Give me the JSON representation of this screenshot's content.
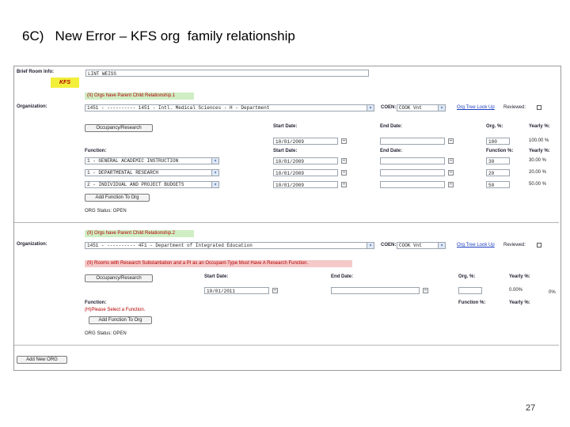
{
  "slide": {
    "title": "6C)   New Error – KFS org  family relationship",
    "page_number": "27"
  },
  "colors": {
    "accent_link": "#1d3fbf",
    "error_text": "#b30000",
    "kfs_badge": "#f2ef3a",
    "info_green": "#cfeec4",
    "error_red": "#f5c9c9"
  },
  "header": {
    "brief_room_info_label": "Brief Room Info:",
    "brief_room_info_value": "LINT WEISS",
    "kfs_badge": "KFS"
  },
  "section1": {
    "message": "(II) Orgs have Parent Child Relationship.1",
    "organization_label": "Organization:",
    "organization_value": "1451 - ---------- 1451 - Intl. Medical Sciences - H - Department",
    "coen_label": "COEN:",
    "coen_value": "COOK Vnt",
    "org_tree_lookup": "Org Tree Look Up",
    "reviewed_label": "Reviewed:",
    "occupancy_button": "Occupancy/Research",
    "start_date_label": "Start Date:",
    "end_date_label": "End Date:",
    "org_pct_label": "Org. %:",
    "yearly_pct_label": "Yearly %:",
    "start_date_value": "10/01/2009",
    "end_date_value": "",
    "org_pct_value": "100",
    "yearly_pct_value": "100.00 %",
    "function_label": "Function:",
    "function_pct_label": "Function %:",
    "functions": [
      {
        "name": "1 - GENERAL ACADEMIC INSTRUCTION",
        "start": "10/01/2009",
        "end": "",
        "pct": "30",
        "yearly": "30.00 %"
      },
      {
        "name": "1 - DEPARTMENTAL RESEARCH",
        "start": "10/01/2009",
        "end": "",
        "pct": "20",
        "yearly": "20.00 %"
      },
      {
        "name": "2 - INDIVIDUAL AND PROJECT BUDGETS",
        "start": "10/01/2009",
        "end": "",
        "pct": "50",
        "yearly": "50.00 %"
      }
    ],
    "add_function_button": "Add Function To Org",
    "org_status": "ORG Status: OPEN"
  },
  "section2": {
    "message": "(II) Orgs have Parent Child Relationship.2",
    "organization_label": "Organization:",
    "organization_value": "1451 - ---------- 4F1 - Department of Integrated Education",
    "coen_label": "COEN:",
    "coen_value": "COOK Vnt",
    "org_tree_lookup": "Org Tree Look Up",
    "reviewed_label": "Reviewed:",
    "error_message": "(II) Rooms with Research Substantiation and a PI as an Occupant-Type Must Have A Research Function.",
    "occupancy_button": "Occupancy/Research",
    "start_date_label": "Start Date:",
    "end_date_label": "End Date:",
    "org_pct_label": "Org. %:",
    "yearly_pct_label": "Yearly %:",
    "start_date_value": "10/01/2011",
    "end_date_value": "",
    "org_pct_value": "",
    "yearly_pct_value": "0.00%",
    "trailing_pct": "0%",
    "function_label": "Function:",
    "function_pct_label": "Function %:",
    "function_error": "(H)Please Select a Function.",
    "add_function_button": "Add Function To Org",
    "org_status": "ORG Status: OPEN"
  },
  "footer": {
    "add_new_org_button": "Add New ORG"
  }
}
